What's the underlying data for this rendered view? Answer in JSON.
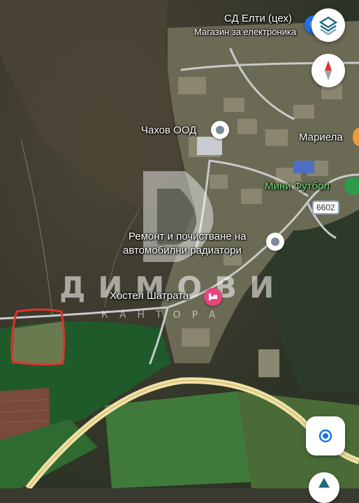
{
  "labels": {
    "elti": "СД Елти (цех)",
    "elti_sub": "Магазин за електроника",
    "chahov": "Чахов ООД",
    "mariela": "Мариела",
    "mini_football": "Мини Футбол",
    "remont_line1": "Ремонт и почистване на",
    "remont_line2": "автомобилни радиатори",
    "hostel": "Хостел Шатрата"
  },
  "road_shield": "6602",
  "watermark": {
    "main": "ДИМОВИ",
    "sub": "КАНТОРА"
  },
  "icons": {
    "layers": "layers-icon",
    "compass": "compass-icon",
    "locate": "my-location-icon",
    "hotel": "hotel-icon",
    "pin": "place-pin-icon"
  },
  "colors": {
    "parcel_outline": "#e0332a",
    "accent_blue": "#1a73e8",
    "hotel_pink": "#e8457c",
    "green_label": "#7fe07a"
  }
}
